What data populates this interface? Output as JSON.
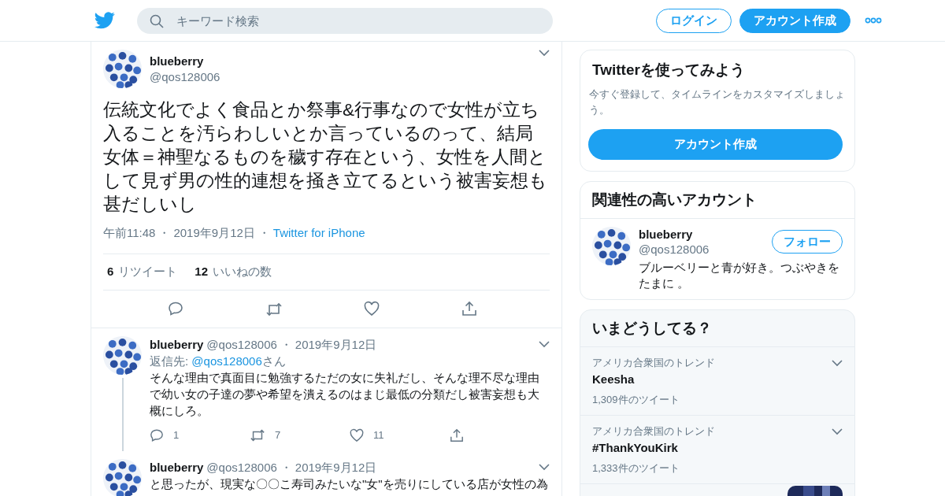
{
  "header": {
    "search": {
      "placeholder": "キーワード検索"
    },
    "buttons": [
      {
        "label": "ログイン",
        "kind": "outline"
      },
      {
        "label": "アカウント作成",
        "kind": "filled"
      }
    ]
  },
  "tweet": {
    "name": "blueberry",
    "handle": "@qos128006",
    "text": "伝統文化でよく食品とか祭事&行事なので女性が立ち入ることを汚らわしいとか言っているのって、結局女体＝神聖なるものを穢す存在という、女性を人間として見ず男の性的連想を掻き立てるという被害妄想も甚だしいし",
    "time": "午前11:48",
    "separators": [
      "・",
      "・"
    ],
    "date": "2019年9月12日",
    "source": "Twitter for iPhone",
    "stats": [
      {
        "count": "6",
        "label": "リツイート"
      },
      {
        "count": "12",
        "label": "いいねの数"
      }
    ]
  },
  "replies": [
    {
      "name": "blueberry",
      "handle": "@qos128006",
      "separator": "・",
      "date": "2019年9月12日",
      "reply_to_label": "返信先:",
      "reply_to": "@qos128006",
      "reply_to_suffix": "さん",
      "text": "そんな理由で真面目に勉強するただの女に失礼だし、そんな理不尽な理由で幼い女の子達の夢や希望を潰えるのはまじ最低の分類だし被害妄想も大概にしろ。",
      "thread_line": true,
      "replies": "1",
      "retweets": "7",
      "likes": "11"
    },
    {
      "name": "blueberry",
      "handle": "@qos128006",
      "separator": "・",
      "date": "2019年9月12日",
      "text": "と思ったが、現実な〇〇こ寿司みたいな\"女\"を売りにしている店が女性の為",
      "thread_line": false
    }
  ],
  "signup_card": {
    "title": "Twitterを使ってみよう",
    "text": "今すぐ登録して、タイムラインをカスタマイズしましょう。",
    "button": "アカウント作成"
  },
  "related": {
    "title": "関連性の高いアカウント",
    "accounts": [
      {
        "name": "blueberry",
        "handle": "@qos128006",
        "bio": "ブルーベリーと青が好き。つぶやきをたまに 。",
        "button": "フォロー"
      }
    ]
  },
  "trends": {
    "title": "いまどうしてる？",
    "items": [
      {
        "kind": "trend",
        "context": "アメリカ合衆国のトレンド",
        "name": "Keesha",
        "count": "1,309件のツイート"
      },
      {
        "kind": "trend",
        "context": "アメリカ合衆国のトレンド",
        "name": "#ThankYouKirk",
        "count": "1,333件のツイート"
      },
      {
        "kind": "picture"
      }
    ]
  }
}
